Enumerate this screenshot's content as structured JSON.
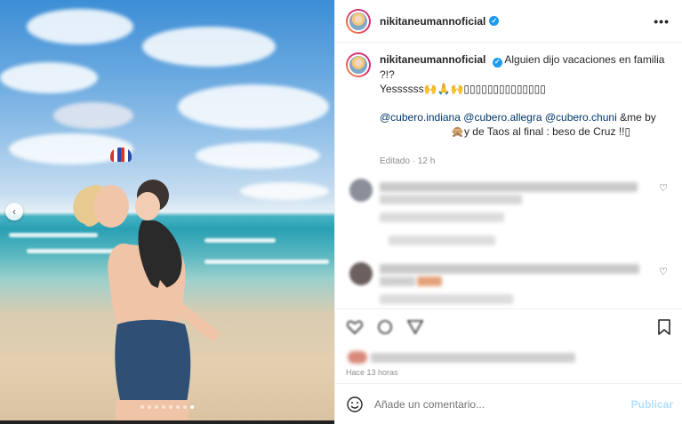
{
  "post": {
    "username": "nikitaneumannoficial",
    "verified": true,
    "more_label": "•••"
  },
  "caption": {
    "username": "nikitaneumannoficial",
    "line1": "Alguien dijo vacaciones en familia ?!?",
    "line2": "Yessssss🙌🙏🙌▯▯▯▯▯▯▯▯▯▯▯▯▯▯",
    "mention1": "@cubero.indiana",
    "mention2": "@cubero.allegra",
    "mention3": "@cubero.chuni",
    "line3_tail": "&me by",
    "line4": "🙊y de Taos al final : beso de Cruz !!▯",
    "meta": "Editado · 12 h"
  },
  "actions": {
    "time_ago": "Hace 13 horas"
  },
  "comment_box": {
    "placeholder": "Añade un comentario...",
    "publish_label": "Publicar"
  },
  "carousel": {
    "prev_label": "‹",
    "dot_count": 8,
    "active_dot": 7
  },
  "icons": {
    "more": "more-options-icon",
    "verified": "verified-badge-icon",
    "heart": "heart-icon",
    "bookmark": "bookmark-icon",
    "emoji": "emoji-smiley-icon",
    "prev": "chevron-left-icon"
  },
  "colors": {
    "verified": "#1d9bf0",
    "mention": "#00376b",
    "publish_disabled": "#b2dffc",
    "muted": "#8e8e8e"
  }
}
